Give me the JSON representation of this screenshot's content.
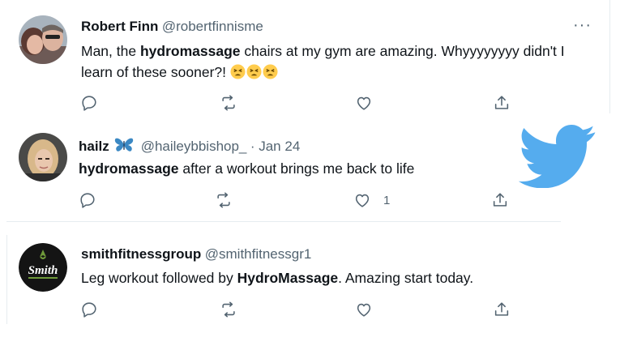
{
  "tweets": [
    {
      "name": "Robert Finn",
      "handle": "@robertfinnisme",
      "date": "",
      "more_label": "···",
      "text_before": "Man, the ",
      "text_bold": "hydromassage",
      "text_after": " chairs at my gym are amazing. Whyyyyyyyy didn't I learn of these sooner?!",
      "emoji": [
        "tired-face",
        "tired-face",
        "tired-face"
      ],
      "likes": ""
    },
    {
      "name": "hailz",
      "name_emoji": "butterfly",
      "handle": "@haileybbishop_",
      "date": "· Jan 24",
      "text_bold": "hydromassage",
      "text_after": " after a workout brings me back to life",
      "likes": "1"
    },
    {
      "name": "smithfitnessgroup",
      "handle": "@smithfitnessgr1",
      "date": "",
      "text_before": "Leg workout followed by ",
      "text_bold": "HydroMassage",
      "text_after": ".  Amazing start today.",
      "likes": "",
      "avatar_logo_text": "Smith"
    }
  ],
  "colors": {
    "twitter_blue": "#55acee",
    "text": "#0f1419",
    "secondary": "#536471",
    "divider": "#e6ecf0"
  },
  "icons": [
    "reply-icon",
    "retweet-icon",
    "like-icon",
    "share-icon",
    "twitter-bird-logo"
  ]
}
